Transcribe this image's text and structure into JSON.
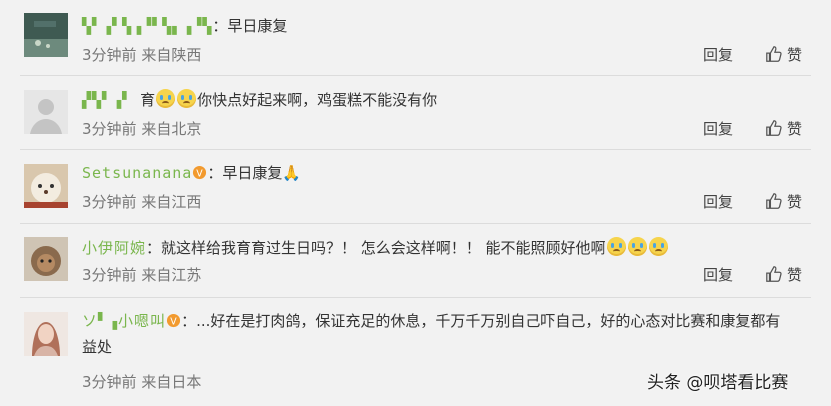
{
  "comments": [
    {
      "user": "▚▘▗▘▚▗▝▘▚▖▗▝▚",
      "text": "：早日康复",
      "time": "3分钟前",
      "source": "来自陕西",
      "reply": "回复",
      "like": "赞"
    },
    {
      "user": "▞▚▘▗▘",
      "text_a": "育",
      "text_b": "你快点好起来啊，鸡蛋糕不能没有你",
      "time": "3分钟前",
      "source": "来自北京",
      "reply": "回复",
      "like": "赞"
    },
    {
      "user": "Setsunanana",
      "text": "：早日康复🙏",
      "time": "3分钟前",
      "source": "来自江西",
      "reply": "回复",
      "like": "赞"
    },
    {
      "user": "小伊阿婉",
      "text": "：就这样给我育育过生日吗？！ 怎么会这样啊！！ 能不能照顾好他啊",
      "time": "3分钟前",
      "source": "来自江苏",
      "reply": "回复",
      "like": "赞"
    },
    {
      "user": "ソ▘▗小嗯叫",
      "text": "：...好在是打肉鸽，保证充足的休息，千万千万别自己吓自己，好的心态对比赛和康复都有益处",
      "time": "3分钟前",
      "source": "来自日本"
    }
  ],
  "watermark": "头条 @呗塔看比赛"
}
